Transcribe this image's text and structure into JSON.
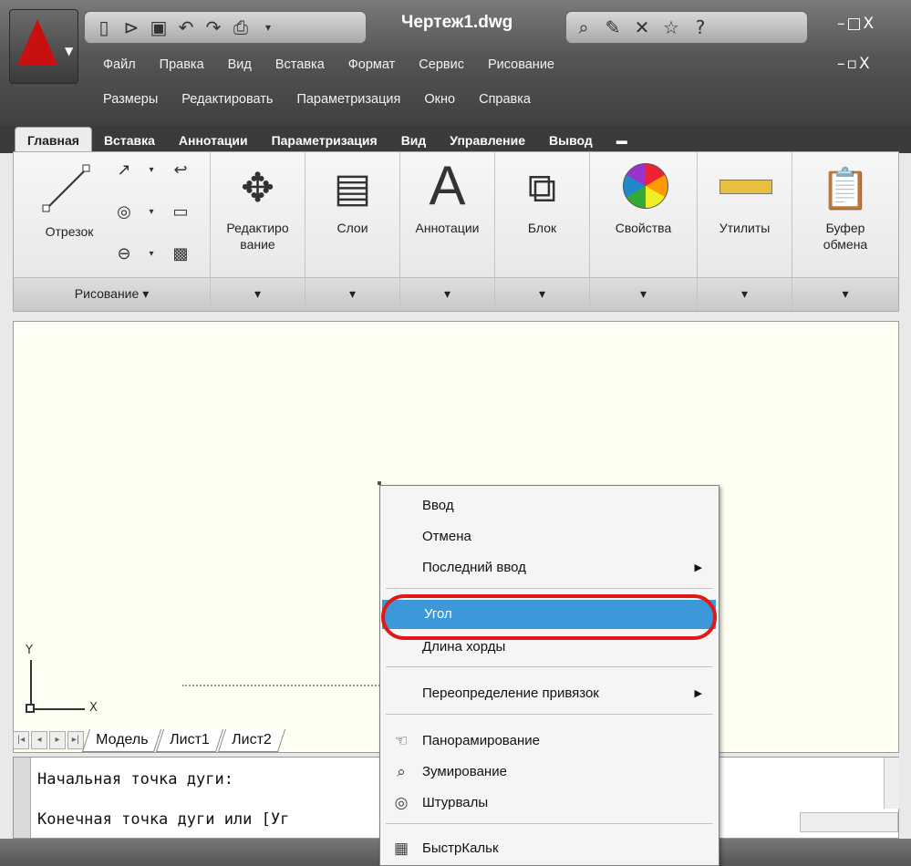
{
  "title_bar": {
    "document_title": "Чертеж1.dwg",
    "window_controls": "–□X",
    "doc_controls": "–▫X"
  },
  "quick_access": [
    "new-icon",
    "open-icon",
    "save-icon",
    "undo-icon",
    "redo-icon",
    "print-icon"
  ],
  "menu_row1": [
    "Файл",
    "Правка",
    "Вид",
    "Вставка",
    "Формат",
    "Сервис",
    "Рисование"
  ],
  "menu_row2": [
    "Размеры",
    "Редактировать",
    "Параметризация",
    "Окно",
    "Справка"
  ],
  "ribbon_tabs": [
    "Главная",
    "Вставка",
    "Аннотации",
    "Параметризация",
    "Вид",
    "Управление",
    "Вывод"
  ],
  "ribbon": {
    "draw_panel": {
      "line_label": "Отрезок",
      "footer": "Рисование"
    },
    "edit_label": "Редактиро\nвание",
    "layers_label": "Слои",
    "annot_label": "Аннотации",
    "block_label": "Блок",
    "props_label": "Свойства",
    "utils_label": "Утилиты",
    "clipboard_label": "Буфер обмена"
  },
  "canvas": {
    "ucs_x": "X",
    "ucs_y": "Y"
  },
  "layout_tabs": [
    "Модель",
    "Лист1",
    "Лист2"
  ],
  "command_line": {
    "line1": "Начальная точка дуги:",
    "line2": "Конечная точка дуги или [Уг"
  },
  "context_menu": {
    "items": {
      "enter": "Ввод",
      "cancel": "Отмена",
      "recent": "Последний ввод",
      "angle": "Угол",
      "chord": "Длина хорды",
      "osnap": "Переопределение привязок",
      "pan": "Панорамирование",
      "zoom": "Зумирование",
      "wheels": "Штурвалы",
      "quickcalc": "БыстрКальк"
    }
  },
  "colors": {
    "highlight": "#3d98d9",
    "ring": "#e01818",
    "canvas_bg": "#fffef2"
  }
}
